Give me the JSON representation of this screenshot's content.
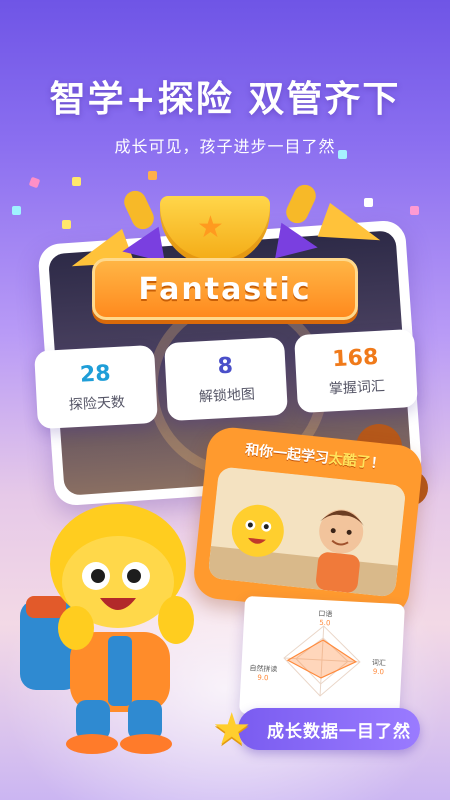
{
  "headline": "智学+探险 双管齐下",
  "subhead": "成长可见，孩子进步一目了然",
  "banner": "Fantastic",
  "stats": [
    {
      "value": "28",
      "label": "探险天数",
      "color": "#1f9ed8"
    },
    {
      "value": "8",
      "label": "解锁地图",
      "color": "#4a4fc9"
    },
    {
      "value": "168",
      "label": "掌握词汇",
      "color": "#f07a1a"
    }
  ],
  "photo": {
    "caption_prefix": "和你一起学习",
    "caption_highlight": "太酷了",
    "caption_suffix": "！"
  },
  "radar": {
    "top_label": "口语",
    "top_value": "5.0",
    "right_label": "词汇",
    "right_value": "9.0",
    "left_label": "自然拼读",
    "left_value": "9.0"
  },
  "pill": "成长数据一目了然",
  "colors": {
    "accent": "#ff8a1e",
    "purple": "#7a5cf0",
    "star": "#ffce2e"
  }
}
